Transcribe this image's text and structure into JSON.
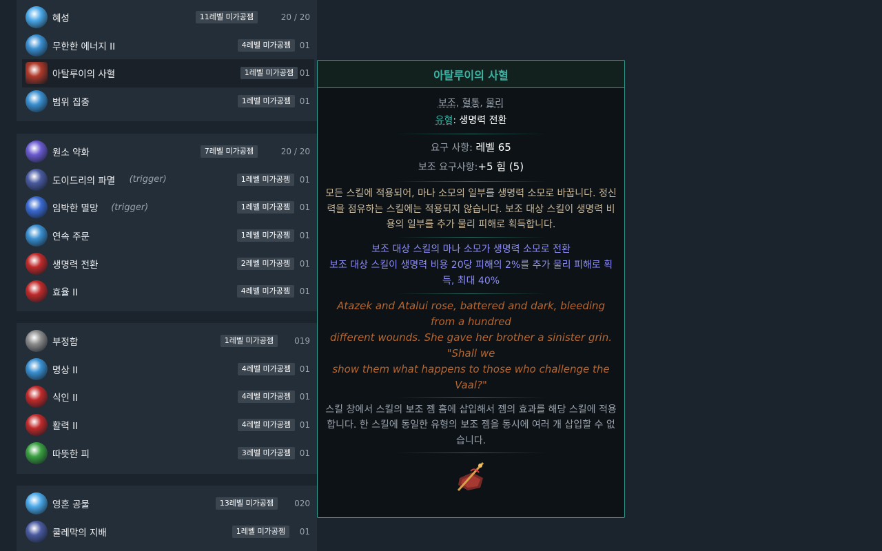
{
  "groups": [
    {
      "rows": [
        {
          "name": "혜성",
          "badge": "11레벨 미가공젬",
          "count": "20 / 20",
          "gem_color": "#4aa8e8",
          "icon": "comet-gem-icon"
        },
        {
          "name": "무한한 에너지 II",
          "badge": "4레벨 미가공젬",
          "count": "01",
          "gem_color": "#3a8fd0",
          "icon": "energy-gem-icon"
        },
        {
          "name": "아탈루이의 사혈",
          "badge": "1레벨 미가공젬",
          "count": "01",
          "gem_color": "#b03a2a",
          "icon": "bloodletting-gem-icon",
          "highlight": true
        },
        {
          "name": "범위 집중",
          "badge": "1레벨 미가공젬",
          "count": "01",
          "gem_color": "#3a8fd0",
          "icon": "area-gem-icon"
        }
      ]
    },
    {
      "rows": [
        {
          "name": "원소 약화",
          "badge": "7레벨 미가공젬",
          "count": "20 / 20",
          "gem_color": "#6a5ad0",
          "icon": "elemental-gem-icon"
        },
        {
          "name": "도이드리의 파멸",
          "trigger": "(trigger)",
          "badge": "1레벨 미가공젬",
          "count": "01",
          "gem_color": "#4a5aa0",
          "icon": "doedre-gem-icon"
        },
        {
          "name": "임박한 멸망",
          "trigger": "(trigger)",
          "badge": "1레벨 미가공젬",
          "count": "01",
          "gem_color": "#3a6ad0",
          "icon": "doom-gem-icon"
        },
        {
          "name": "연속 주문",
          "badge": "1레벨 미가공젬",
          "count": "01",
          "gem_color": "#3a8fd0",
          "icon": "spell-echo-gem-icon"
        },
        {
          "name": "생명력 전환",
          "badge": "2레벨 미가공젬",
          "count": "01",
          "gem_color": "#c02a2a",
          "icon": "life-gem-icon"
        },
        {
          "name": "효율 II",
          "badge": "4레벨 미가공젬",
          "count": "01",
          "gem_color": "#c02a2a",
          "icon": "efficiency-gem-icon"
        }
      ]
    },
    {
      "rows": [
        {
          "name": "부정함",
          "badge": "1레벨 미가공젬",
          "count": "019",
          "gem_color": "#8a8a8a",
          "icon": "unholy-gem-icon"
        },
        {
          "name": "명상 II",
          "badge": "4레벨 미가공젬",
          "count": "01",
          "gem_color": "#3a8fd0",
          "icon": "meditation-gem-icon"
        },
        {
          "name": "식인 II",
          "badge": "4레벨 미가공젬",
          "count": "01",
          "gem_color": "#c02a2a",
          "icon": "cannibal-gem-icon"
        },
        {
          "name": "활력 II",
          "badge": "4레벨 미가공젬",
          "count": "01",
          "gem_color": "#c02a2a",
          "icon": "vitality-gem-icon"
        },
        {
          "name": "따뜻한 피",
          "badge": "3레벨 미가공젬",
          "count": "01",
          "gem_color": "#3aa040",
          "icon": "warm-blood-gem-icon"
        }
      ]
    },
    {
      "rows": [
        {
          "name": "영혼 공물",
          "badge": "13레벨 미가공젬",
          "count": "020",
          "gem_color": "#4aa8e8",
          "icon": "soul-offering-gem-icon"
        },
        {
          "name": "쿨레막의 지배",
          "badge": "1레벨 미가공젬",
          "count": "01",
          "gem_color": "#4a5aa0",
          "icon": "kulemak-gem-icon"
        }
      ]
    }
  ],
  "tooltip": {
    "title": "아탈루이의 사혈",
    "tags": [
      "보조",
      "혈통",
      "물리"
    ],
    "type_label": "유형",
    "type_value": "생명력 전환",
    "req_label": "요구 사항:",
    "req_value": "레벨 65",
    "support_req_label": "보조 요구사항:",
    "support_req_value": "+5 힘 (5)",
    "description": "모든 스킬에 적용되어, 마나 소모의 일부를 생명력 소모로 바꿉니다. 정신력을 점유하는 스킬에는 적용되지 않습니다. 보조 대상 스킬이 생명력 비용의 일부를 추가 물리 피해로 획득합니다.",
    "mods": [
      "보조 대상 스킬의 마나 소모가 생명력 소모로 전환",
      "보조 대상 스킬이 생명력 비용 20당 피해의 2%를 추가 물리 피해로 획득, 최대 40%"
    ],
    "flavor": [
      "Atazek and Atalui rose, battered and dark, bleeding from a hundred",
      "different wounds. She gave her brother a sinister grin. \"Shall we",
      "show them what happens to those who challenge the Vaal?\""
    ],
    "help": "스킬 창에서 스킬의 보조 젬 홈에 삽입해서 젬의 효과를 해당 스킬에 적용합니다. 한 스킬에 동일한 유형의 보조 젬을 동시에 여러 개 삽입할 수 없습니다.",
    "art_icon": "bloodletting-art-icon"
  }
}
